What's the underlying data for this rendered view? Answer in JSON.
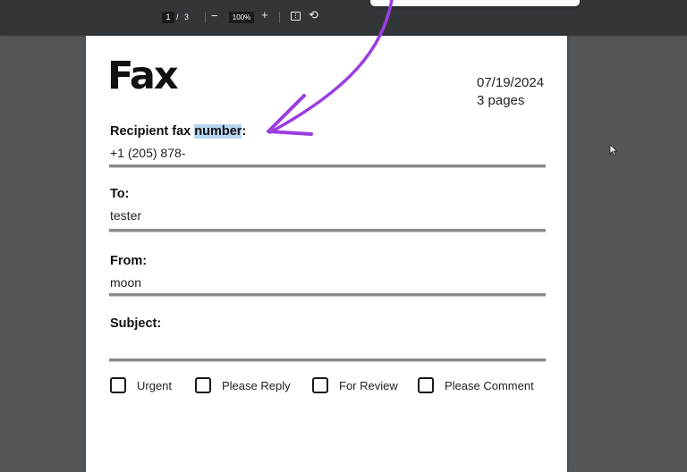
{
  "toolbar": {
    "current_page": "1",
    "page_separator": "/",
    "total_pages": "3",
    "zoom_out_symbol": "−",
    "zoom_level": "100%",
    "zoom_in_symbol": "+",
    "fit_icon": "fit-to-page-icon",
    "rotate_icon": "rotate-icon",
    "rotate_symbol": "⟲"
  },
  "document": {
    "title": "Fax",
    "date": "07/19/2024",
    "pages": "3 pages",
    "fields": [
      {
        "label_prefix": "Recipient fax ",
        "label_highlight": "number",
        "label_suffix": ":",
        "value": "+1 (205) 878-"
      },
      {
        "label": "To:",
        "value": "tester"
      },
      {
        "label": "From:",
        "value": "moon"
      },
      {
        "label": "Subject:",
        "value": ""
      }
    ],
    "checkboxes": [
      {
        "label": "Urgent",
        "checked": false
      },
      {
        "label": "Please Reply",
        "checked": false
      },
      {
        "label": "For Review",
        "checked": false
      },
      {
        "label": "Please Comment",
        "checked": false
      }
    ]
  },
  "annotation": {
    "arrow_color": "#9b3ee0",
    "highlight_color": "#b7d5ee"
  }
}
